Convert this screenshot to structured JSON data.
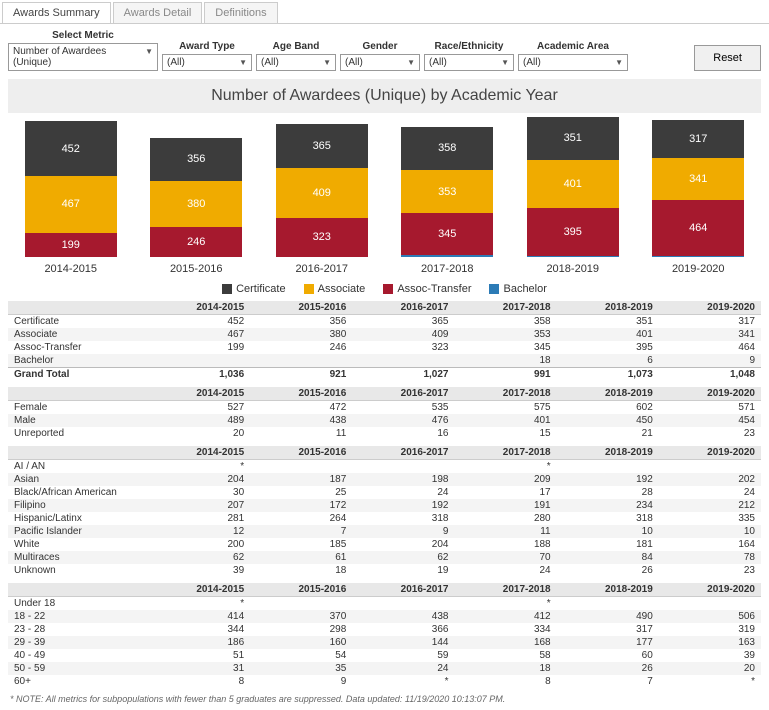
{
  "tabs": [
    "Awards Summary",
    "Awards Detail",
    "Definitions"
  ],
  "filters": {
    "metric": {
      "label": "Select Metric",
      "value": "Number of Awardees (Unique)"
    },
    "award": {
      "label": "Award Type",
      "value": "(All)"
    },
    "age": {
      "label": "Age Band",
      "value": "(All)"
    },
    "gender": {
      "label": "Gender",
      "value": "(All)"
    },
    "race": {
      "label": "Race/Ethnicity",
      "value": "(All)"
    },
    "area": {
      "label": "Academic Area",
      "value": "(All)"
    },
    "reset": "Reset"
  },
  "chart_title": "Number of Awardees (Unique) by Academic Year",
  "chart_data": {
    "type": "bar",
    "categories": [
      "2014-2015",
      "2015-2016",
      "2016-2017",
      "2017-2018",
      "2018-2019",
      "2019-2020"
    ],
    "series": [
      {
        "name": "Certificate",
        "color": "#3c3c3c",
        "values": [
          452,
          356,
          365,
          358,
          351,
          317
        ]
      },
      {
        "name": "Associate",
        "color": "#f0ab00",
        "values": [
          467,
          380,
          409,
          353,
          401,
          341
        ]
      },
      {
        "name": "Assoc-Transfer",
        "color": "#a6192e",
        "values": [
          199,
          246,
          323,
          345,
          395,
          464
        ]
      },
      {
        "name": "Bachelor",
        "color": "#2c7bb6",
        "values": [
          null,
          null,
          null,
          18,
          6,
          9
        ]
      }
    ],
    "title": "Number of Awardees (Unique) by Academic Year",
    "xlabel": "",
    "ylabel": "",
    "ylim": [
      0,
      1200
    ]
  },
  "table_years": [
    "2014-2015",
    "2015-2016",
    "2016-2017",
    "2017-2018",
    "2018-2019",
    "2019-2020"
  ],
  "table_award": {
    "rows": [
      {
        "label": "Certificate",
        "v": [
          "452",
          "356",
          "365",
          "358",
          "351",
          "317"
        ]
      },
      {
        "label": "Associate",
        "v": [
          "467",
          "380",
          "409",
          "353",
          "401",
          "341"
        ]
      },
      {
        "label": "Assoc-Transfer",
        "v": [
          "199",
          "246",
          "323",
          "345",
          "395",
          "464"
        ]
      },
      {
        "label": "Bachelor",
        "v": [
          "",
          "",
          "",
          "18",
          "6",
          "9"
        ]
      }
    ],
    "total": {
      "label": "Grand Total",
      "v": [
        "1,036",
        "921",
        "1,027",
        "991",
        "1,073",
        "1,048"
      ]
    }
  },
  "table_gender": {
    "rows": [
      {
        "label": "Female",
        "v": [
          "527",
          "472",
          "535",
          "575",
          "602",
          "571"
        ]
      },
      {
        "label": "Male",
        "v": [
          "489",
          "438",
          "476",
          "401",
          "450",
          "454"
        ]
      },
      {
        "label": "Unreported",
        "v": [
          "20",
          "11",
          "16",
          "15",
          "21",
          "23"
        ]
      }
    ]
  },
  "table_race": {
    "rows": [
      {
        "label": "AI / AN",
        "v": [
          "*",
          "",
          "",
          "*",
          "",
          ""
        ]
      },
      {
        "label": "Asian",
        "v": [
          "204",
          "187",
          "198",
          "209",
          "192",
          "202"
        ]
      },
      {
        "label": "Black/African American",
        "v": [
          "30",
          "25",
          "24",
          "17",
          "28",
          "24"
        ]
      },
      {
        "label": "Filipino",
        "v": [
          "207",
          "172",
          "192",
          "191",
          "234",
          "212"
        ]
      },
      {
        "label": "Hispanic/Latinx",
        "v": [
          "281",
          "264",
          "318",
          "280",
          "318",
          "335"
        ]
      },
      {
        "label": "Pacific Islander",
        "v": [
          "12",
          "7",
          "9",
          "11",
          "10",
          "10"
        ]
      },
      {
        "label": "White",
        "v": [
          "200",
          "185",
          "204",
          "188",
          "181",
          "164"
        ]
      },
      {
        "label": "Multiraces",
        "v": [
          "62",
          "61",
          "62",
          "70",
          "84",
          "78"
        ]
      },
      {
        "label": "Unknown",
        "v": [
          "39",
          "18",
          "19",
          "24",
          "26",
          "23"
        ]
      }
    ]
  },
  "table_age": {
    "rows": [
      {
        "label": "Under 18",
        "v": [
          "*",
          "",
          "",
          "*",
          "",
          ""
        ]
      },
      {
        "label": "18 - 22",
        "v": [
          "414",
          "370",
          "438",
          "412",
          "490",
          "506"
        ]
      },
      {
        "label": "23 - 28",
        "v": [
          "344",
          "298",
          "366",
          "334",
          "317",
          "319"
        ]
      },
      {
        "label": "29 - 39",
        "v": [
          "186",
          "160",
          "144",
          "168",
          "177",
          "163"
        ]
      },
      {
        "label": "40 - 49",
        "v": [
          "51",
          "54",
          "59",
          "58",
          "60",
          "39"
        ]
      },
      {
        "label": "50 - 59",
        "v": [
          "31",
          "35",
          "24",
          "18",
          "26",
          "20"
        ]
      },
      {
        "label": "60+",
        "v": [
          "8",
          "9",
          "*",
          "8",
          "7",
          "*"
        ]
      }
    ]
  },
  "note": "* NOTE: All metrics for subpopulations with fewer than 5 graduates are suppressed. Data updated: 11/19/2020 10:13:07 PM."
}
